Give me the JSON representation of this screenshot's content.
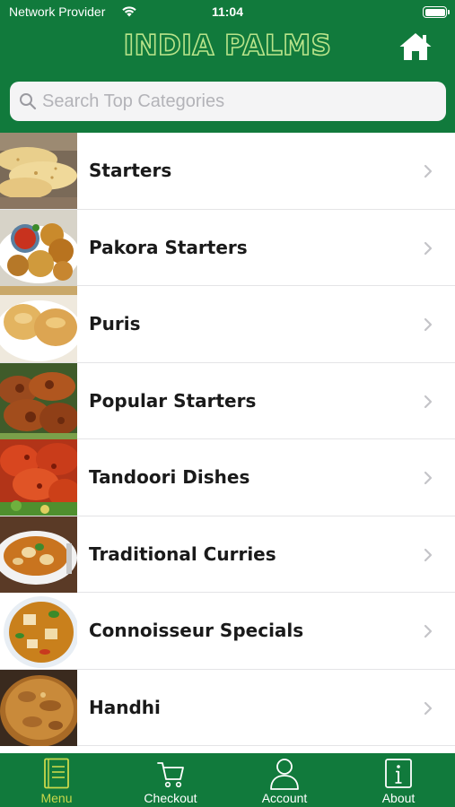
{
  "status_bar": {
    "carrier": "Network Provider",
    "time": "11:04"
  },
  "header": {
    "title": "INDIA PALMS"
  },
  "search": {
    "placeholder": "Search Top Categories",
    "value": ""
  },
  "categories": [
    {
      "label": "Starters",
      "image": "papadum"
    },
    {
      "label": "Pakora Starters",
      "image": "pakora"
    },
    {
      "label": "Puris",
      "image": "puri"
    },
    {
      "label": "Popular Starters",
      "image": "grilled-chicken"
    },
    {
      "label": "Tandoori Dishes",
      "image": "tandoori-chicken"
    },
    {
      "label": "Traditional Curries",
      "image": "curry-bowl"
    },
    {
      "label": "Connoisseur Specials",
      "image": "paneer-curry"
    },
    {
      "label": "Handhi",
      "image": "handhi-curry"
    }
  ],
  "tabs": [
    {
      "label": "Menu",
      "icon": "menu-book-icon",
      "active": true
    },
    {
      "label": "Checkout",
      "icon": "cart-icon",
      "active": false
    },
    {
      "label": "Account",
      "icon": "person-icon",
      "active": false
    },
    {
      "label": "About",
      "icon": "info-icon",
      "active": false
    }
  ],
  "colors": {
    "brand_green": "#117a3c",
    "title_outline": "#b9e48a",
    "active_tab": "#c9d84b"
  }
}
